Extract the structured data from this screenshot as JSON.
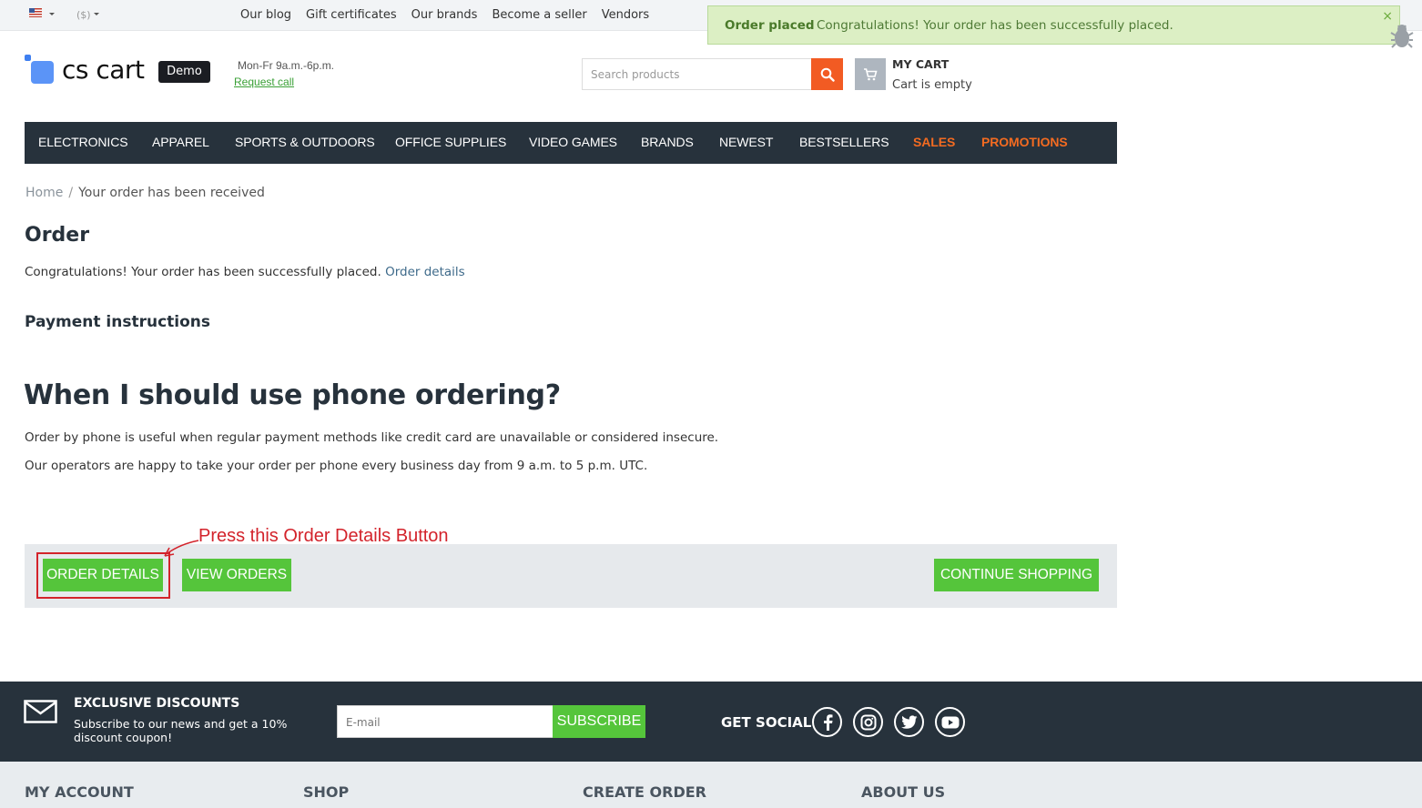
{
  "topbar": {
    "currency": "($)",
    "links": [
      "Our blog",
      "Gift certificates",
      "Our brands",
      "Become a seller",
      "Vendors"
    ]
  },
  "notification": {
    "title": "Order placed",
    "text": "Congratulations! Your order has been successfully placed.",
    "close": "×"
  },
  "header": {
    "logo_text": "cs cart",
    "demo_badge": "Demo",
    "hours": "Mon-Fr 9a.m.-6p.m.",
    "request_call": "Request call",
    "search_placeholder": "Search products",
    "cart_title": "MY CART",
    "cart_status": "Cart is empty"
  },
  "nav": {
    "items": [
      "ELECTRONICS",
      "APPAREL",
      "SPORTS & OUTDOORS",
      "OFFICE SUPPLIES",
      "VIDEO GAMES",
      "BRANDS",
      "NEWEST",
      "BESTSELLERS",
      "SALES",
      "PROMOTIONS"
    ]
  },
  "breadcrumb": {
    "home": "Home",
    "separator": "/",
    "current": "Your order has been received"
  },
  "main": {
    "order_heading": "Order",
    "congrats_text": "Congratulations! Your order has been successfully placed.",
    "order_details_link": "Order details",
    "payment_heading": "Payment instructions",
    "phone_heading": "When I should use phone ordering?",
    "para1": "Order by phone is useful when regular payment methods like credit card are unavailable or considered insecure.",
    "para2": "Our operators are happy to take your order per phone every business day from 9 a.m. to 5 p.m. UTC."
  },
  "buttons": {
    "order_details": "ORDER DETAILS",
    "view_orders": "VIEW ORDERS",
    "continue_shopping": "CONTINUE SHOPPING"
  },
  "annotation": {
    "text": "Press this Order Details Button",
    "color": "#d3232b"
  },
  "footer": {
    "discount_title": "EXCLUSIVE DISCOUNTS",
    "discount_text": "Subscribe to our news and get a 10% discount coupon!",
    "email_placeholder": "E-mail",
    "subscribe": "SUBSCRIBE",
    "social_title": "GET SOCIAL",
    "social_icons": [
      "facebook-icon",
      "instagram-icon",
      "twitter-icon",
      "youtube-icon"
    ],
    "columns": [
      "MY ACCOUNT",
      "SHOP",
      "CREATE ORDER",
      "ABOUT US"
    ]
  },
  "colors": {
    "accent_green": "#55c53b",
    "accent_orange": "#f36b21",
    "nav_bg": "#27323c"
  }
}
